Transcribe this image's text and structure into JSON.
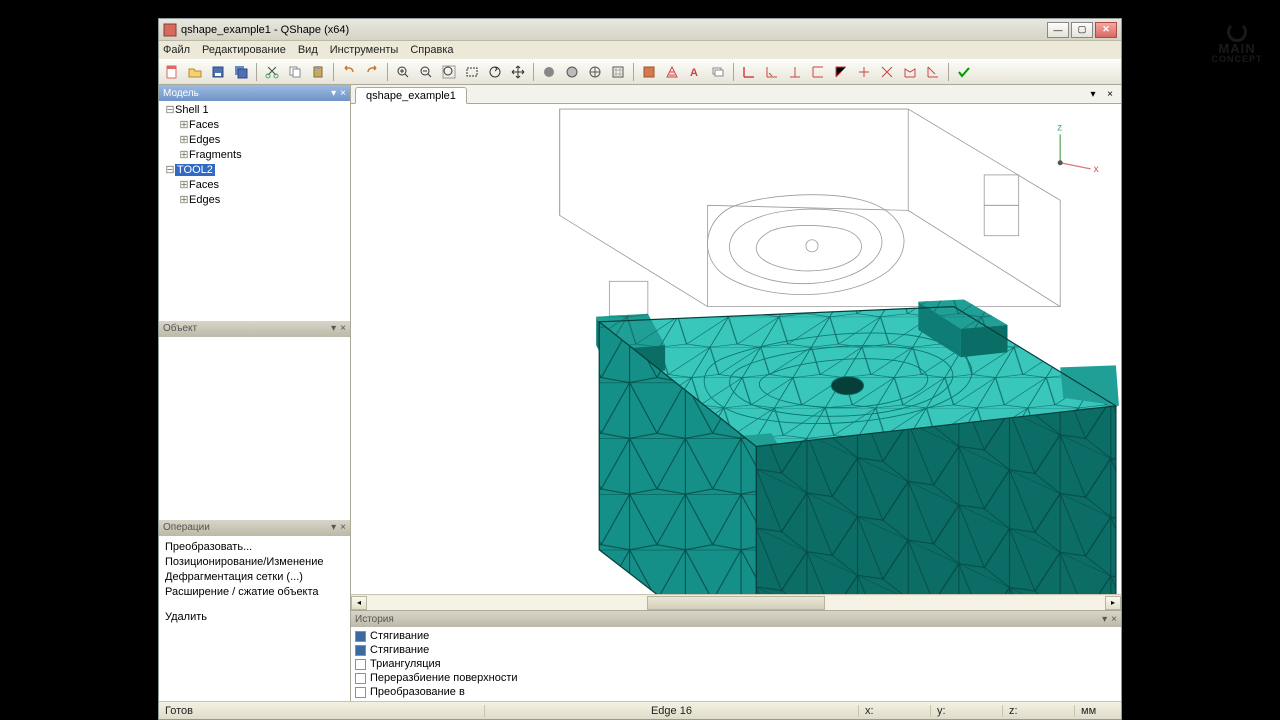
{
  "window": {
    "title": "qshape_example1 - QShape (x64)"
  },
  "menu": [
    "Файл",
    "Редактирование",
    "Вид",
    "Инструменты",
    "Справка"
  ],
  "panels": {
    "model": {
      "title": "Модель"
    },
    "object": {
      "title": "Объект"
    },
    "operations": {
      "title": "Операции"
    },
    "history": {
      "title": "История"
    }
  },
  "tree": {
    "root": "Shell 1",
    "children1": [
      "Faces",
      "Edges",
      "Fragments"
    ],
    "tool": "TOOL2",
    "children2": [
      "Faces",
      "Edges"
    ]
  },
  "operations": [
    "Преобразовать...",
    "Позиционирование/Изменение",
    "Дефрагментация сетки (...)",
    "Расширение / сжатие объекта",
    "",
    "Удалить"
  ],
  "tab": {
    "label": "qshape_example1"
  },
  "history_items": [
    {
      "checked": true,
      "label": "Стягивание"
    },
    {
      "checked": true,
      "label": "Стягивание"
    },
    {
      "checked": false,
      "label": "Триангуляция"
    },
    {
      "checked": false,
      "label": "Переразбиение поверхности"
    },
    {
      "checked": false,
      "label": "Преобразование в"
    }
  ],
  "status": {
    "ready": "Готов",
    "info": "Edge 16",
    "x": "x:",
    "y": "y:",
    "z": "z:",
    "unit": "мм"
  },
  "axis": {
    "z": "z",
    "x": "x"
  },
  "logo": {
    "line1": "MAIN",
    "line2": "CONCEPT"
  }
}
